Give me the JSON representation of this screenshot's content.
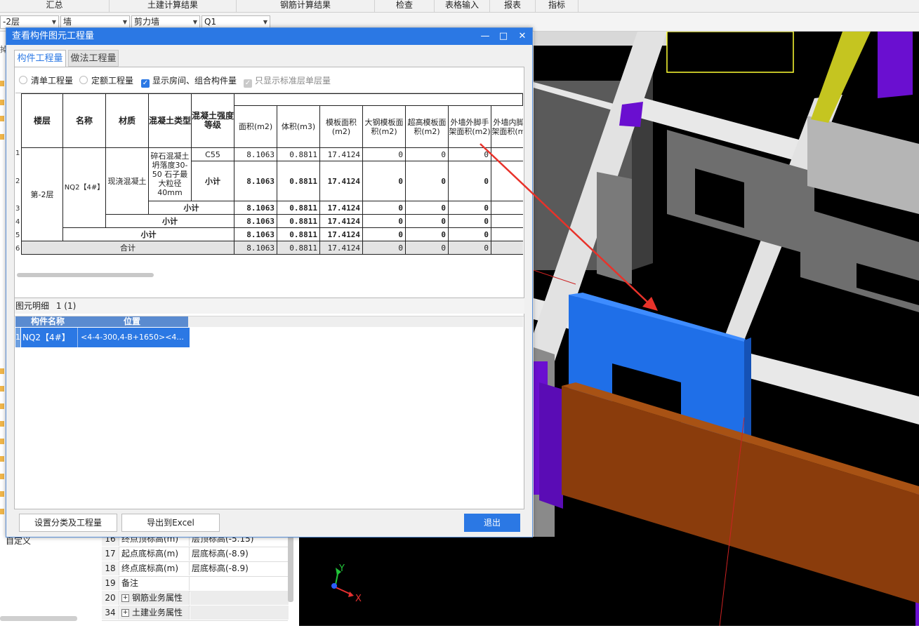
{
  "menubar": {
    "tabs": [
      "汇总",
      "土建计算结果",
      "钢筋计算结果",
      "检查",
      "表格输入",
      "报表",
      "指标"
    ]
  },
  "toolbar": {
    "floor_value": "-2层",
    "category_value": "墙",
    "type_value": "剪力墙",
    "component_value": "Q1"
  },
  "left_panel": {
    "fragment_text": "掉",
    "custom_label": "自定义"
  },
  "properties": {
    "rows": [
      {
        "num": "16",
        "name": "终点顶标高(m)",
        "value": "层顶标高(-5.15)"
      },
      {
        "num": "17",
        "name": "起点底标高(m)",
        "value": "层底标高(-8.9)"
      },
      {
        "num": "18",
        "name": "终点底标高(m)",
        "value": "层底标高(-8.9)"
      },
      {
        "num": "19",
        "name": "备注",
        "value": ""
      },
      {
        "num": "20",
        "name": "钢筋业务属性",
        "value": "",
        "expandable": true
      },
      {
        "num": "34",
        "name": "土建业务属性",
        "value": "",
        "expandable": true
      }
    ]
  },
  "viewport": {
    "axis_y": "Y",
    "axis_x": "X"
  },
  "dialog": {
    "title": "查看构件图元工程量",
    "tabs": [
      "构件工程量",
      "做法工程量"
    ],
    "active_tab": "构件工程量",
    "options": {
      "list_qty": "清单工程量",
      "quota_qty": "定额工程量",
      "show_rooms": "显示房间、组合构件量",
      "std_floor_only": "只显示标准层单层量"
    },
    "table": {
      "headers": {
        "floor": "楼层",
        "name": "名称",
        "material": "材质",
        "concrete_type": "混凝土类型",
        "concrete_grade": "混凝土强度等级",
        "area": "面积(m2)",
        "volume": "体积(m3)",
        "formwork_area": "模板面积(m2)",
        "large_steel_formwork": "大钢模板面积(m2)",
        "high_formwork": "超高模板面积(m2)",
        "outer_scaffold": "外墙外脚手架面积(m2)",
        "inner_scaffold": "外墙内脚手架面积(m2)"
      },
      "row_numbers": [
        "1",
        "2",
        "3",
        "4",
        "5",
        "6"
      ],
      "floor": "第-2层",
      "name": "NQ2【4#】",
      "material": "现浇混凝土",
      "concrete_type": "碎石混凝土 坍落度30-50 石子最大粒径40mm",
      "concrete_grade": "C55",
      "subtotal_label": "小计",
      "total_label": "合计",
      "values": {
        "area": "8.1063",
        "volume": "0.8811",
        "formwork_area": "17.4124",
        "large_steel_formwork": "0",
        "high_formwork": "0",
        "outer_scaffold": "0"
      }
    },
    "detail": {
      "title": "图元明细",
      "count": "1 (1)",
      "columns": [
        "构件名称",
        "位置"
      ],
      "rows": [
        {
          "num": "1",
          "name": "NQ2【4#】",
          "position": "<4-4-300,4-B+1650><4..."
        }
      ]
    },
    "buttons": {
      "set_category": "设置分类及工程量",
      "export_excel": "导出到Excel",
      "exit": "退出"
    }
  },
  "colors": {
    "accent": "#2b78e4",
    "selected_wall": "#1f6fe8",
    "purple_column": "#6a0fd0",
    "orange_wall": "#8a3c0c",
    "yellow_selection": "#ffff33",
    "annotation_arrow": "#e8322a"
  }
}
